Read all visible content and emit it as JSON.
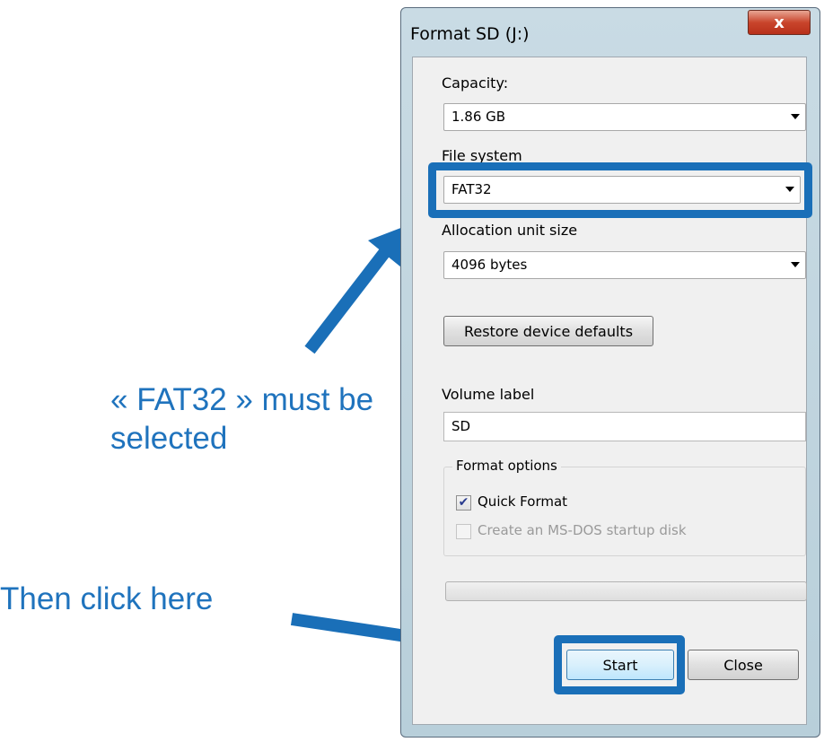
{
  "window": {
    "title": "Format SD (J:)",
    "close_glyph": "x"
  },
  "capacity": {
    "label": "Capacity:",
    "value": "1.86 GB"
  },
  "file_system": {
    "label": "File system",
    "value": "FAT32"
  },
  "allocation": {
    "label": "Allocation unit size",
    "value": "4096 bytes"
  },
  "restore_button": "Restore device defaults",
  "volume": {
    "label": "Volume label",
    "value": "SD"
  },
  "format_options": {
    "legend": "Format options",
    "quick_format": {
      "label": "Quick Format",
      "checked": true
    },
    "msdos": {
      "label": "Create an MS-DOS startup disk",
      "checked": false,
      "disabled": true
    }
  },
  "progress": 0,
  "buttons": {
    "start": "Start",
    "close": "Close"
  },
  "annotations": {
    "select_hint": "« FAT32 » must be selected",
    "click_hint": "Then click here"
  },
  "colors": {
    "annotation": "#1f73bd",
    "highlight": "#1a6fb8",
    "close_button": "#c9452c"
  },
  "icons": {
    "close": "close-icon",
    "dropdown": "chevron-down-icon",
    "checkmark": "checkmark-icon"
  }
}
